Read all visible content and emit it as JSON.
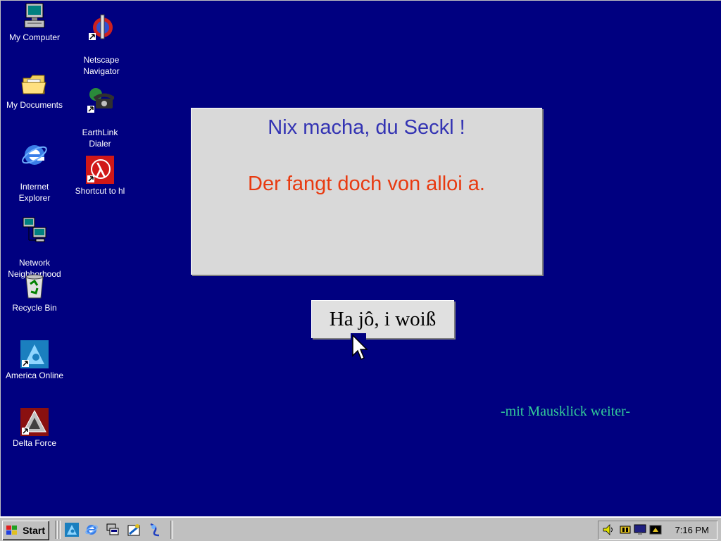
{
  "desktop_icons": [
    {
      "label": "My Computer"
    },
    {
      "label": "My Documents"
    },
    {
      "label": "Internet\nExplorer"
    },
    {
      "label": "Network\nNeighborhood"
    },
    {
      "label": "Recycle Bin"
    },
    {
      "label": "America Online"
    },
    {
      "label": "Delta Force"
    },
    {
      "label": "Netscape\nNavigator"
    },
    {
      "label": "EarthLink\nDialer"
    },
    {
      "label": "Shortcut to hl"
    }
  ],
  "dialog": {
    "line1": "Nix macha, du Seckl !",
    "line2": "Der fangt doch von alloi a."
  },
  "reply_button": {
    "label": "Ha jô, i woiß"
  },
  "hint": "-mit Mausklick weiter-",
  "taskbar": {
    "start_label": "Start",
    "clock": "7:16 PM",
    "quick_launch": [
      "aol-icon",
      "internet-explorer-icon",
      "desktop-icon",
      "channels-icon",
      "outlook-icon"
    ],
    "tray_icons": [
      "volume-icon",
      "network-icon",
      "monitor-icon",
      "scheduler-icon"
    ]
  },
  "colors": {
    "desktop": "#000080",
    "dialog_bg": "#d9d9d9",
    "line1": "#3333b3",
    "line2": "#e83a10",
    "hint": "#33cc99"
  }
}
